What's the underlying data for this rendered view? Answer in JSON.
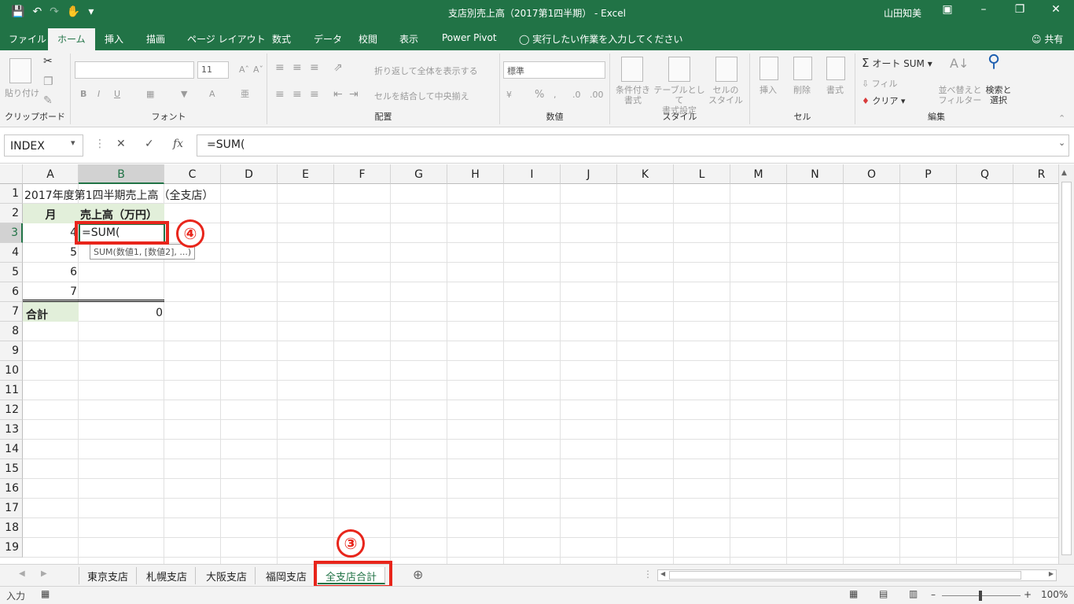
{
  "window": {
    "title": "支店別売上高（2017第1四半期） - Excel",
    "user": "山田知美",
    "share": "共有",
    "tell_me": "実行したい作業を入力してください"
  },
  "tabs": [
    "ファイル",
    "ホーム",
    "挿入",
    "描画",
    "ページ レイアウト",
    "数式",
    "データ",
    "校閲",
    "表示",
    "Power Pivot"
  ],
  "ribbon": {
    "clipboard": {
      "label": "クリップボード",
      "paste": "貼り付け"
    },
    "font": {
      "label": "フォント",
      "size": "11",
      "bold": "B",
      "italic": "I",
      "underline": "U"
    },
    "alignment": {
      "label": "配置",
      "wrap": "折り返して全体を表示する",
      "merge": "セルを結合して中央揃え"
    },
    "number": {
      "label": "数値",
      "format": "標準",
      "percent": "%"
    },
    "styles": {
      "label": "スタイル",
      "conditional": "条件付き\n書式",
      "table": "テーブルとして\n書式設定",
      "cell_style": "セルの\nスタイル"
    },
    "cells": {
      "label": "セル",
      "insert": "挿入",
      "delete": "削除",
      "format": "書式"
    },
    "editing": {
      "label": "編集",
      "autosum": "オート SUM",
      "fill": "フィル",
      "clear": "クリア",
      "sort": "並べ替えと\nフィルター",
      "find": "検索と\n選択"
    }
  },
  "formula_bar": {
    "name_box": "INDEX",
    "formula": "=SUM("
  },
  "columns": [
    "A",
    "B",
    "C",
    "D",
    "E",
    "F",
    "G",
    "H",
    "I",
    "J",
    "K",
    "L",
    "M",
    "N",
    "O",
    "P",
    "Q",
    "R"
  ],
  "rows": [
    "1",
    "2",
    "3",
    "4",
    "5",
    "6",
    "7",
    "8",
    "9",
    "10",
    "11",
    "12",
    "13",
    "14",
    "15",
    "16",
    "17",
    "18",
    "19"
  ],
  "cells": {
    "A1": "2017年度第1四半期売上高（全支店）",
    "A2": "月",
    "B2": "売上高（万円）",
    "A3": "4",
    "B3": "=SUM(",
    "A4": "5",
    "A5": "6",
    "A6": "7",
    "A7": "合計",
    "B7": "0"
  },
  "tooltip": "SUM(数値1, [数値2], ...)",
  "annotations": {
    "step_sheet": "③",
    "step_formula": "④"
  },
  "sheet_tabs": [
    "東京支店",
    "札幌支店",
    "大阪支店",
    "福岡支店",
    "全支店合計"
  ],
  "active_sheet_index": 4,
  "status": {
    "mode": "入力",
    "zoom": "100%"
  },
  "colors": {
    "excel_green": "#217346",
    "highlight_red": "#e8251b",
    "header_fill": "#e2efda"
  }
}
